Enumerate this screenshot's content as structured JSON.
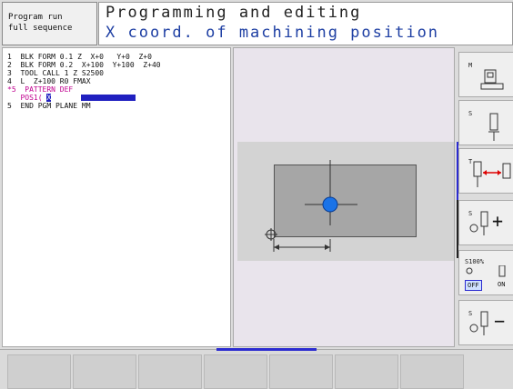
{
  "mode_label": [
    "Program run",
    "full sequence"
  ],
  "header": {
    "title": "Programming and editing",
    "subtitle": "X coord. of machining position"
  },
  "program_lines": [
    "1  BLK FORM 0.1 Z  X+0   Y+0  Z+0",
    "2  BLK FORM 0.2  X+100  Y+100  Z+40",
    "3  TOOL CALL 1 Z S2500",
    "4  L  Z+100 R0 FMAX",
    "*5  PATTERN DEF",
    "5  END PGM PLANE MM"
  ],
  "pos_line": {
    "prefix": "   POS1( ",
    "cursor": "X"
  },
  "softkeys": [
    {
      "label": "M"
    },
    {
      "label": "S"
    },
    {
      "label": "T"
    },
    {
      "label": "S",
      "sign": "+"
    },
    {
      "label": "S100%",
      "state_off": "OFF",
      "state_on": "ON"
    },
    {
      "label": "S",
      "sign": "−"
    }
  ],
  "colors": {
    "accent": "#2b2bd0",
    "header_sub": "#1e3fa3",
    "pos_marker": "#1a73e8"
  }
}
